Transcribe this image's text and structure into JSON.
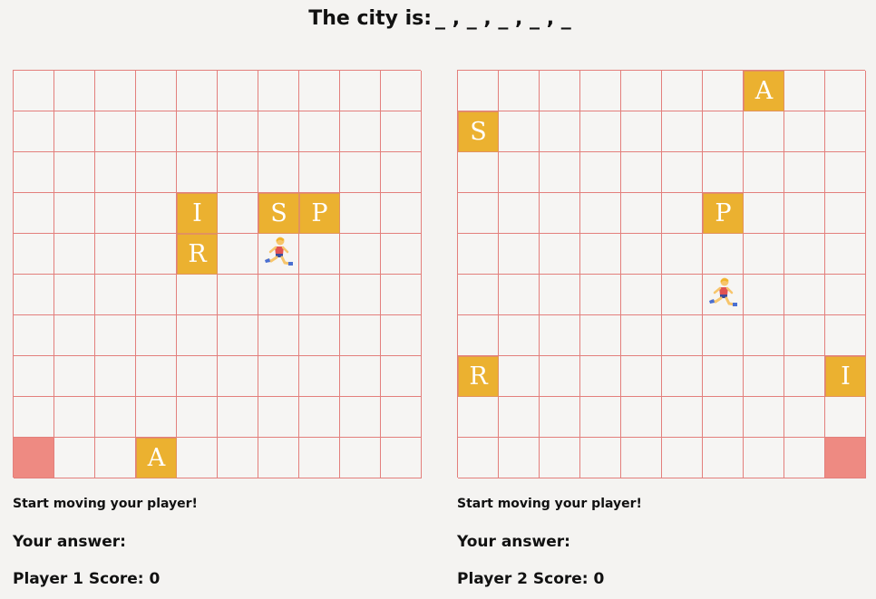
{
  "header": {
    "prefix": "The city is:",
    "blanks": "_ , _ , _ , _ , _"
  },
  "colors": {
    "cell_border": "#e37f7c",
    "letter_tile": "#ebb130",
    "goal_tile": "#ee8a82",
    "background": "#f4f3f1"
  },
  "player1": {
    "letters": [
      {
        "row": 3,
        "col": 4,
        "letter": "I"
      },
      {
        "row": 3,
        "col": 6,
        "letter": "S"
      },
      {
        "row": 3,
        "col": 7,
        "letter": "P"
      },
      {
        "row": 4,
        "col": 4,
        "letter": "R"
      },
      {
        "row": 9,
        "col": 3,
        "letter": "A"
      }
    ],
    "player_pos": {
      "row": 4,
      "col": 6
    },
    "goal_pos": {
      "row": 9,
      "col": 0
    },
    "status": "Start moving your player!",
    "answer_label": "Your answer:",
    "score_label": "Player 1 Score: 0"
  },
  "player2": {
    "letters": [
      {
        "row": 0,
        "col": 7,
        "letter": "A"
      },
      {
        "row": 1,
        "col": 0,
        "letter": "S"
      },
      {
        "row": 3,
        "col": 6,
        "letter": "P"
      },
      {
        "row": 7,
        "col": 0,
        "letter": "R"
      },
      {
        "row": 7,
        "col": 9,
        "letter": "I"
      }
    ],
    "player_pos": {
      "row": 5,
      "col": 6
    },
    "goal_pos": {
      "row": 9,
      "col": 9
    },
    "status": "Start moving your player!",
    "answer_label": "Your answer:",
    "score_label": "Player 2 Score: 0"
  }
}
